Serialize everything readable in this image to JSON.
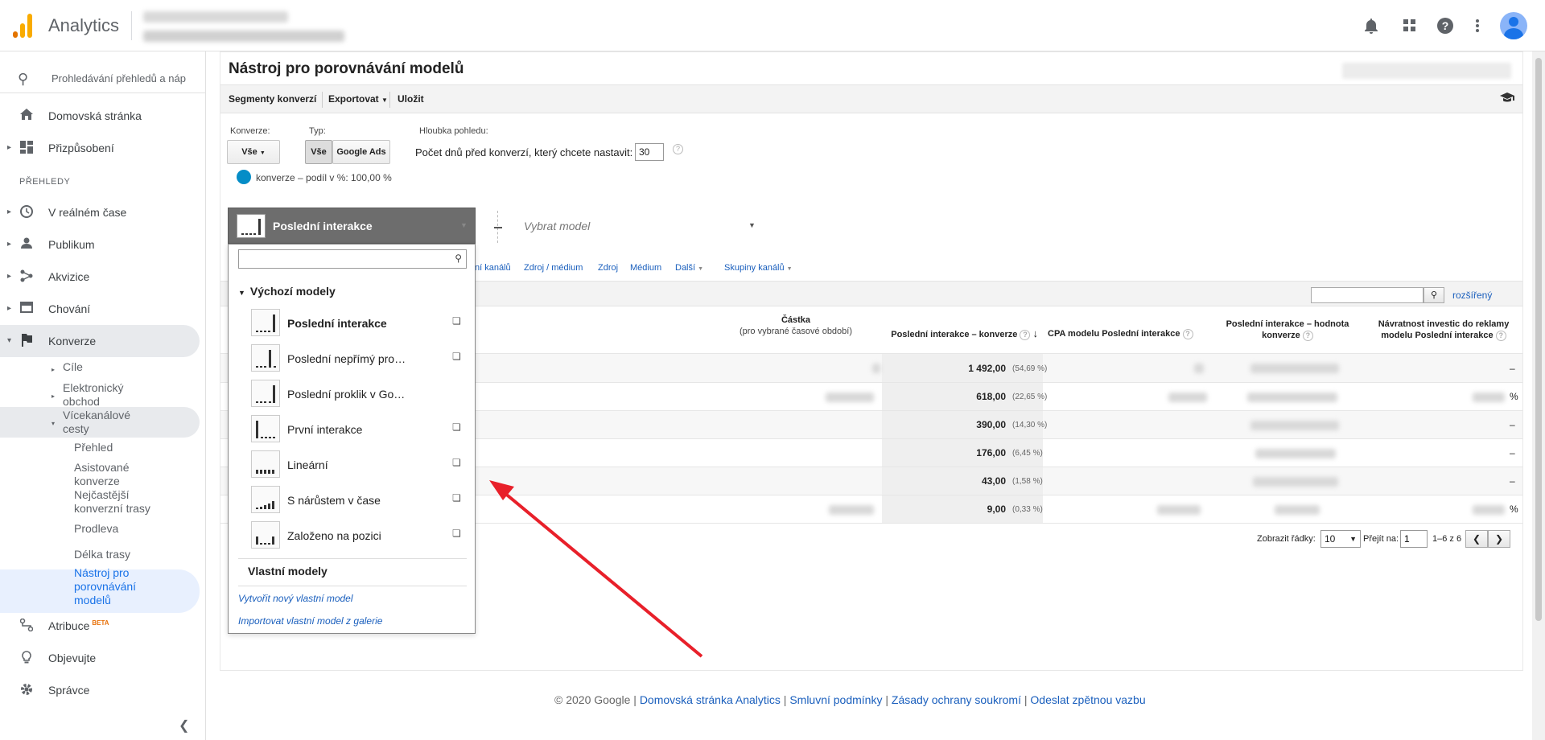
{
  "app": {
    "title": "Analytics"
  },
  "sidebar": {
    "search_placeholder": "Prohledávání přehledů a náp",
    "home": "Domovská stránka",
    "customize": "Přizpůsobení",
    "section": "PŘEHLEDY",
    "realtime": "V reálném čase",
    "audience": "Publikum",
    "acquisition": "Akvizice",
    "behavior": "Chování",
    "conversions": "Konverze",
    "goals": "Cíle",
    "ecommerce": "Elektronický obchod",
    "multichannel": "Vícekanálové cesty",
    "overview": "Přehled",
    "assisted": "Asistované konverze",
    "top_paths": "Nejčastější konverzní trasy",
    "time_lag": "Prodleva",
    "path_length": "Délka trasy",
    "model_tool": "Nástroj pro porovnávání modelů",
    "attribution": "Atribuce",
    "beta": "BETA",
    "discover": "Objevujte",
    "admin": "Správce"
  },
  "page": {
    "title": "Nástroj pro porovnávání modelů",
    "toolbar": {
      "segments": "Segmenty konverzí",
      "export": "Exportovat",
      "save": "Uložit"
    },
    "conversion_label": "Konverze:",
    "conversion_value": "Vše",
    "type_label": "Typ:",
    "type_all": "Vše",
    "type_ads": "Google Ads",
    "lookback_label": "Hloubka pohledu:",
    "days_label": "Počet dnů před konverzí, který chcete nastavit:",
    "days_value": "30",
    "share_label": "konverze – podíl v %: 100,00 %",
    "select_model": "Vybrat model",
    "dims": {
      "channel": "ní kanálů",
      "source_medium": "Zdroj / médium",
      "source": "Zdroj",
      "medium": "Médium",
      "more": "Další",
      "groups": "Skupiny kanálů"
    },
    "advanced": "rozšířený",
    "col_amount": "Částka",
    "col_amount_sub": "(pro vybrané časové období)",
    "col_conv": "Poslední interakce – konverze",
    "col_cpa": "CPA modelu Poslední interakce",
    "col_value": "Poslední interakce – hodnota konverze",
    "col_roas": "Návratnost investic do reklamy modelu Poslední interakce",
    "rows": [
      {
        "val": "1 492,00",
        "pct": "(54,69 %)",
        "end": "–"
      },
      {
        "val": "618,00",
        "pct": "(22,65 %)",
        "end": "%"
      },
      {
        "val": "390,00",
        "pct": "(14,30 %)",
        "end": "–"
      },
      {
        "val": "176,00",
        "pct": "(6,45 %)",
        "end": "–"
      },
      {
        "val": "43,00",
        "pct": "(1,58 %)",
        "end": "–"
      },
      {
        "val": "9,00",
        "pct": "(0,33 %)",
        "end": "%"
      }
    ],
    "pager": {
      "show_rows": "Zobrazit řádky:",
      "rows_value": "10",
      "goto": "Přejít na:",
      "page_value": "1",
      "range": "1–6 z 6"
    }
  },
  "dropdown": {
    "selected": "Poslední interakce",
    "group": "Výchozí modely",
    "items": [
      {
        "name": "Poslední interakce"
      },
      {
        "name": "Poslední nepřímý pro…"
      },
      {
        "name": "Poslední proklik v Go…"
      },
      {
        "name": "První interakce"
      },
      {
        "name": "Lineární"
      },
      {
        "name": "S nárůstem v čase"
      },
      {
        "name": "Založeno na pozici"
      }
    ],
    "custom": "Vlastní modely",
    "create": "Vytvořit nový vlastní model",
    "import": "Importovat vlastní model z galerie"
  },
  "footer": {
    "copyright": "© 2020 Google",
    "home": "Domovská stránka Analytics",
    "terms": "Smluvní podmínky",
    "privacy": "Zásady ochrany soukromí",
    "feedback": "Odeslat zpětnou vazbu"
  },
  "colors": {
    "accent": "#1a73e8",
    "arrow": "#e8202a",
    "dot": "#058dc7"
  }
}
